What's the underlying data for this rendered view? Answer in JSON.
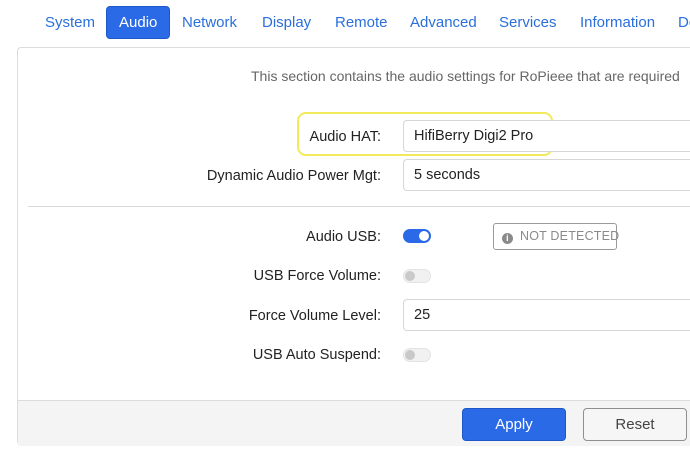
{
  "tabs": [
    {
      "label": "System",
      "active": false
    },
    {
      "label": "Audio",
      "active": true
    },
    {
      "label": "Network",
      "active": false
    },
    {
      "label": "Display",
      "active": false
    },
    {
      "label": "Remote",
      "active": false
    },
    {
      "label": "Advanced",
      "active": false
    },
    {
      "label": "Services",
      "active": false
    },
    {
      "label": "Information",
      "active": false
    },
    {
      "label": "De",
      "active": false
    }
  ],
  "audio": {
    "description": "This section contains the audio settings for RoPieee that are required",
    "audio_hat": {
      "label": "Audio HAT:",
      "value": "HifiBerry Digi2 Pro"
    },
    "power_mgt": {
      "label": "Dynamic Audio Power Mgt:",
      "value": "5 seconds"
    },
    "audio_usb": {
      "label": "Audio USB:",
      "enabled": true,
      "status": "NOT DETECTED"
    },
    "usb_force_volume": {
      "label": "USB Force Volume:",
      "enabled": false
    },
    "force_volume_level": {
      "label": "Force Volume Level:",
      "value": "25"
    },
    "usb_auto_suspend": {
      "label": "USB Auto Suspend:",
      "enabled": false
    }
  },
  "footer": {
    "apply_label": "Apply",
    "reset_label": "Reset"
  },
  "colors": {
    "accent": "#2a6ae6",
    "highlight": "#f2ea5a"
  },
  "icons": {
    "status_icon": "info-icon"
  }
}
